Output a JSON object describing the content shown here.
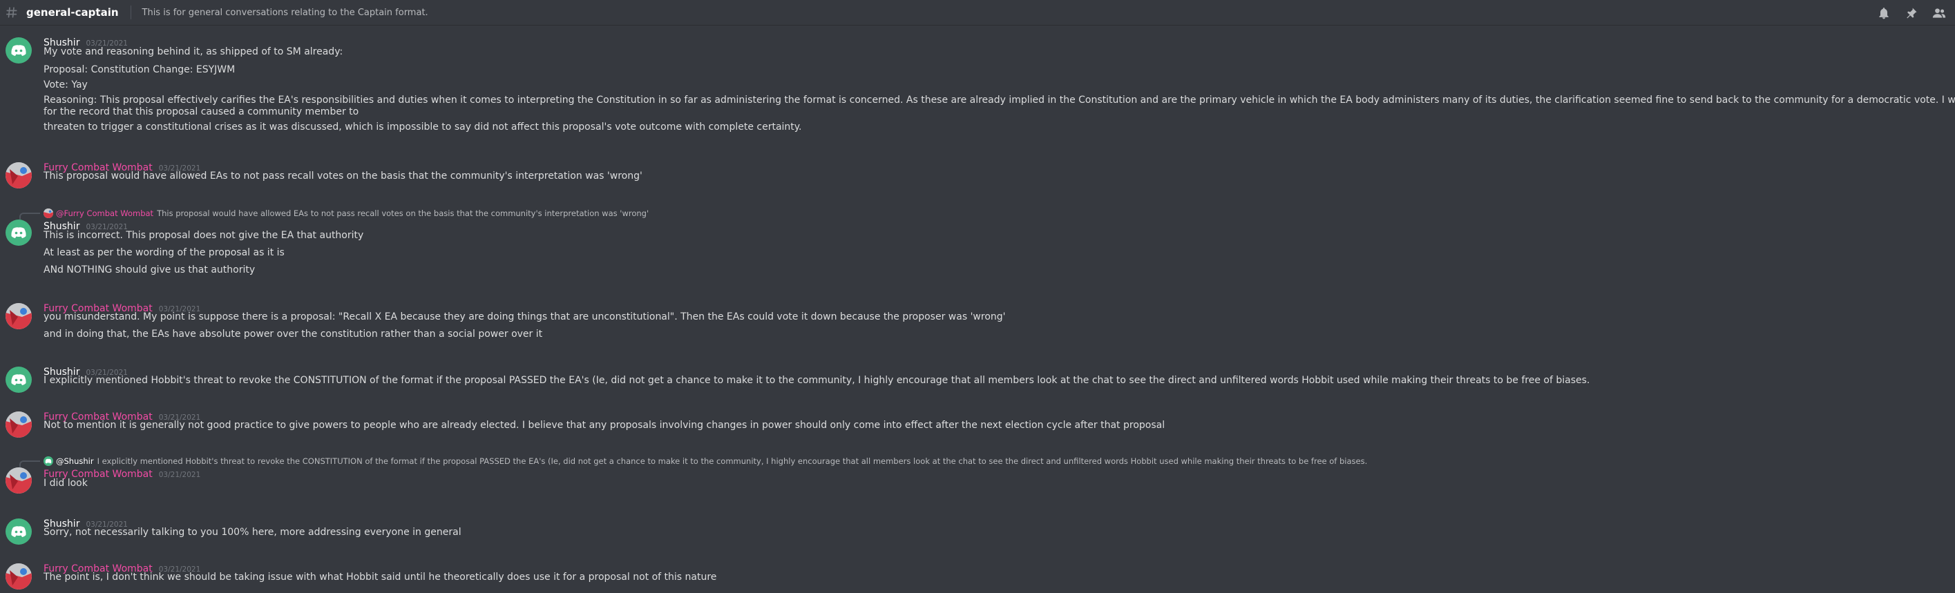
{
  "channel": {
    "name": "general-captain",
    "topic": "This is for general conversations relating to the Captain format."
  },
  "header_icons": [
    "bell-icon",
    "pin-icon",
    "members-icon"
  ],
  "colors": {
    "background": "#36393f",
    "pink_name": "#f24ca5",
    "discord_green": "#43b581"
  },
  "messages": [
    {
      "author": "Shushir",
      "timestamp": "03/21/2021",
      "lines": [
        "My vote and reasoning behind it, as shipped of to SM already:",
        "Proposal: Constitution Change: ESYJWM",
        "Vote: Yay",
        "Reasoning: This proposal effectively carifies the EA's responsibilities and duties when it comes to interpreting the Constitution in so far as administering the format is concerned. As these are already implied in the Constitution and are the primary vehicle in which the EA body administers many of its duties, the clarification seemed fine to send back to the community for a democratic vote. I would also like to state",
        "for the record that this proposal caused a community member to",
        "threaten to trigger a constitutional crises as it was discussed, which is impossible to say did not affect this proposal's vote outcome with complete certainty."
      ]
    },
    {
      "author": "Furry Combat Wombat",
      "timestamp": "03/21/2021",
      "lines": [
        "This proposal would have allowed EAs to not pass recall votes on the basis that the community's interpretation was 'wrong'"
      ]
    },
    {
      "reply": {
        "mention": "@Furry Combat Wombat",
        "text": "This proposal would have allowed EAs to not pass recall votes on the basis that the community's interpretation was 'wrong'"
      },
      "author": "Shushir",
      "timestamp": "03/21/2021",
      "lines": [
        "This is incorrect. This proposal does not give the EA that authority",
        "At least as per the wording of the proposal as it is",
        "ANd NOTHING should give us that authority"
      ]
    },
    {
      "author": "Furry Combat Wombat",
      "timestamp": "03/21/2021",
      "lines": [
        "you misunderstand. My point is suppose there is a proposal: \"Recall X EA because they are doing things that are unconstitutional\". Then the EAs could vote it down because the proposer was 'wrong'",
        "and in doing that, the EAs have absolute power over the constitution rather than a social power over it"
      ]
    },
    {
      "author": "Shushir",
      "timestamp": "03/21/2021",
      "lines": [
        "I explicitly mentioned Hobbit's threat to revoke the CONSTITUTION of the format if the proposal PASSED the EA's (Ie, did not get a chance to make it to the community, I highly encourage that all members look at the chat to see the direct and unfiltered words Hobbit used while making their threats to be free of biases."
      ]
    },
    {
      "author": "Furry Combat Wombat",
      "timestamp": "03/21/2021",
      "lines": [
        "Not to mention it is generally not good practice to give powers to people who are already elected. I believe that any proposals involving changes in power should only come into effect after the next election cycle after that proposal"
      ]
    },
    {
      "reply": {
        "mention": "@Shushir",
        "text": "I explicitly mentioned Hobbit's threat to revoke the CONSTITUTION of the format if the proposal PASSED the EA's (Ie, did not get a chance to make it to the community, I highly encourage that all members look at the chat to see the direct and unfiltered words Hobbit used while making their threats to be free of biases."
      },
      "author": "Furry Combat Wombat",
      "timestamp": "03/21/2021",
      "lines": [
        "I did look"
      ]
    },
    {
      "author": "Shushir",
      "timestamp": "03/21/2021",
      "lines": [
        "Sorry, not necessarily talking to you 100% here, more addressing everyone in general"
      ]
    },
    {
      "author": "Furry Combat Wombat",
      "timestamp": "03/21/2021",
      "lines": [
        "The point is, I don't think we should be taking issue with what Hobbit said until he theoretically does use it for a proposal not of this nature"
      ]
    }
  ]
}
